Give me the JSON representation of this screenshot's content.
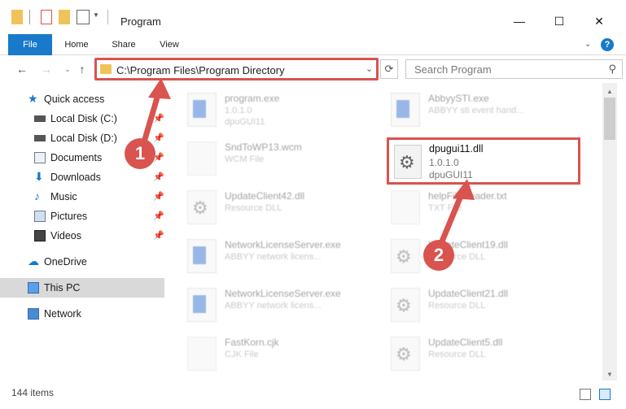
{
  "window": {
    "title": "Program",
    "controls": {
      "minimize": "—",
      "maximize": "☐",
      "close": "✕"
    }
  },
  "ribbon": {
    "tabs": [
      "File",
      "Home",
      "Share",
      "View"
    ],
    "help": "?"
  },
  "navigation": {
    "address": "C:\\Program Files\\Program Directory",
    "search_placeholder": "Search Program"
  },
  "sidebar": {
    "items": [
      {
        "label": "Quick access",
        "icon": "star-icon"
      },
      {
        "label": "Local Disk (C:)",
        "icon": "drive-icon",
        "pinned": true
      },
      {
        "label": "Local Disk (D:)",
        "icon": "drive-icon",
        "pinned": true
      },
      {
        "label": "Documents",
        "icon": "documents-icon",
        "pinned": true
      },
      {
        "label": "Downloads",
        "icon": "download-icon",
        "pinned": true
      },
      {
        "label": "Music",
        "icon": "music-icon",
        "pinned": true
      },
      {
        "label": "Pictures",
        "icon": "pictures-icon",
        "pinned": true
      },
      {
        "label": "Videos",
        "icon": "videos-icon",
        "pinned": true
      },
      {
        "label": "OneDrive",
        "icon": "cloud-icon"
      },
      {
        "label": "This PC",
        "icon": "computer-icon",
        "selected": true
      },
      {
        "label": "Network",
        "icon": "network-icon"
      }
    ]
  },
  "files": [
    {
      "name": "program.exe",
      "l2": "1.0.1.0",
      "l3": "dpuGUI11",
      "icon": "app-icon"
    },
    {
      "name": "AbbyySTI.exe",
      "l2": "ABBYY sti event hand...",
      "l3": "",
      "icon": "app-icon"
    },
    {
      "name": "SndToWP13.wcm",
      "l2": "WCM File",
      "l3": "",
      "icon": "doc-icon"
    },
    {
      "name": "dpugui11.dll",
      "l2": "1.0.1.0",
      "l3": "dpuGUI11",
      "icon": "gear-icon",
      "highlighted": true
    },
    {
      "name": "UpdateClient42.dll",
      "l2": "Resource DLL",
      "l3": "",
      "icon": "gear-icon"
    },
    {
      "name": "helpFileReader.txt",
      "l2": "TXT File",
      "l3": "",
      "icon": "doc-icon"
    },
    {
      "name": "NetworkLicenseServer.exe",
      "l2": "ABBYY network licens...",
      "l3": "",
      "icon": "app-icon"
    },
    {
      "name": "UpdateClient19.dll",
      "l2": "Resource DLL",
      "l3": "",
      "icon": "gear-icon"
    },
    {
      "name": "NetworkLicenseServer.exe",
      "l2": "ABBYY network licens...",
      "l3": "",
      "icon": "app-icon"
    },
    {
      "name": "UpdateClient21.dll",
      "l2": "Resource DLL",
      "l3": "",
      "icon": "gear-icon"
    },
    {
      "name": "FastKorn.cjk",
      "l2": "CJK File",
      "l3": "",
      "icon": "doc-icon"
    },
    {
      "name": "UpdateClient5.dll",
      "l2": "Resource DLL",
      "l3": "",
      "icon": "gear-icon"
    }
  ],
  "status": {
    "items_count": "144 items"
  },
  "markers": [
    "1",
    "2"
  ],
  "colors": {
    "accent": "#1979ca",
    "highlight": "#d9534f",
    "selected_bg": "#d9d9d9"
  }
}
